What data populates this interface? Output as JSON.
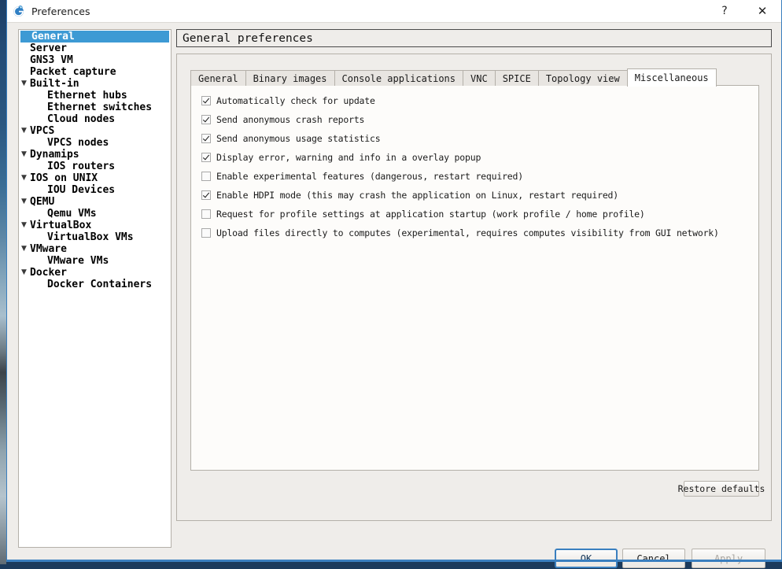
{
  "window": {
    "title": "Preferences",
    "icon": "gns3-logo-icon",
    "help_label": "?",
    "close_label": "✕",
    "accent_color": "#3a7fbf"
  },
  "sidebar": {
    "items": [
      {
        "label": "General",
        "depth": 0,
        "arrow": "",
        "selected": true
      },
      {
        "label": "Server",
        "depth": 0,
        "arrow": "",
        "selected": false
      },
      {
        "label": "GNS3 VM",
        "depth": 0,
        "arrow": "",
        "selected": false
      },
      {
        "label": "Packet capture",
        "depth": 0,
        "arrow": "",
        "selected": false
      },
      {
        "label": "Built-in",
        "depth": 0,
        "arrow": "▼",
        "selected": false
      },
      {
        "label": "Ethernet hubs",
        "depth": 1,
        "arrow": "",
        "selected": false
      },
      {
        "label": "Ethernet switches",
        "depth": 1,
        "arrow": "",
        "selected": false
      },
      {
        "label": "Cloud nodes",
        "depth": 1,
        "arrow": "",
        "selected": false
      },
      {
        "label": "VPCS",
        "depth": 0,
        "arrow": "▼",
        "selected": false
      },
      {
        "label": "VPCS nodes",
        "depth": 1,
        "arrow": "",
        "selected": false
      },
      {
        "label": "Dynamips",
        "depth": 0,
        "arrow": "▼",
        "selected": false
      },
      {
        "label": "IOS routers",
        "depth": 1,
        "arrow": "",
        "selected": false
      },
      {
        "label": "IOS on UNIX",
        "depth": 0,
        "arrow": "▼",
        "selected": false
      },
      {
        "label": "IOU Devices",
        "depth": 1,
        "arrow": "",
        "selected": false
      },
      {
        "label": "QEMU",
        "depth": 0,
        "arrow": "▼",
        "selected": false
      },
      {
        "label": "Qemu VMs",
        "depth": 1,
        "arrow": "",
        "selected": false
      },
      {
        "label": "VirtualBox",
        "depth": 0,
        "arrow": "▼",
        "selected": false
      },
      {
        "label": "VirtualBox VMs",
        "depth": 1,
        "arrow": "",
        "selected": false
      },
      {
        "label": "VMware",
        "depth": 0,
        "arrow": "▼",
        "selected": false
      },
      {
        "label": "VMware VMs",
        "depth": 1,
        "arrow": "",
        "selected": false
      },
      {
        "label": "Docker",
        "depth": 0,
        "arrow": "▼",
        "selected": false
      },
      {
        "label": "Docker Containers",
        "depth": 1,
        "arrow": "",
        "selected": false
      }
    ]
  },
  "main": {
    "page_title": "General preferences",
    "tabs": [
      {
        "label": "General",
        "active": false
      },
      {
        "label": "Binary images",
        "active": false
      },
      {
        "label": "Console applications",
        "active": false
      },
      {
        "label": "VNC",
        "active": false
      },
      {
        "label": "SPICE",
        "active": false
      },
      {
        "label": "Topology view",
        "active": false
      },
      {
        "label": "Miscellaneous",
        "active": true
      }
    ],
    "checkboxes": [
      {
        "label": "Automatically check for update",
        "checked": true
      },
      {
        "label": "Send anonymous crash reports",
        "checked": true
      },
      {
        "label": "Send anonymous usage statistics",
        "checked": true
      },
      {
        "label": "Display error, warning and info in a overlay popup",
        "checked": true
      },
      {
        "label": "Enable experimental features (dangerous, restart required)",
        "checked": false
      },
      {
        "label": "Enable HDPI mode (this may crash the application on Linux, restart required)",
        "checked": true
      },
      {
        "label": "Request for profile settings at application startup  (work profile / home profile)",
        "checked": false
      },
      {
        "label": "Upload files directly to computes (experimental, requires computes visibility from GUI network)",
        "checked": false
      }
    ],
    "restore_defaults_label": "Restore defaults"
  },
  "footer": {
    "ok_label": "OK",
    "cancel_label": "Cancel",
    "apply_label": "Apply"
  }
}
